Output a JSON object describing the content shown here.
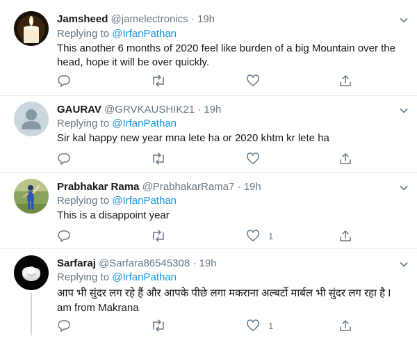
{
  "tweets": [
    {
      "name": "Jamsheed",
      "handle": "@jamelectronics",
      "time": "19h",
      "replying_label": "Replying to",
      "replying_to": "@IrfanPathan",
      "text": "This another 6 months of 2020 feel like burden of a big Mountain over the head, hope it will be over quickly.",
      "avatar": "candle-avatar",
      "reply_count": "",
      "retweet_count": "",
      "like_count": ""
    },
    {
      "name": "GAURAV",
      "handle": "@GRVKAUSHIK21",
      "time": "19h",
      "replying_label": "Replying to",
      "replying_to": "@IrfanPathan",
      "text": "Sir kal happy new year mna lete ha or 2020 khtm kr lete ha",
      "avatar": "default-avatar",
      "reply_count": "",
      "retweet_count": "",
      "like_count": ""
    },
    {
      "name": "Prabhakar Rama",
      "handle": "@PrabhakarRama7",
      "time": "19h",
      "replying_label": "Replying to",
      "replying_to": "@IrfanPathan",
      "text": "This is a disappoint year",
      "avatar": "cricket-avatar",
      "reply_count": "",
      "retweet_count": "",
      "like_count": "1"
    },
    {
      "name": "Sarfaraj",
      "handle": "@Sarfara86545308",
      "time": "19h",
      "replying_label": "Replying to",
      "replying_to": "@IrfanPathan",
      "text": "आप भी सुंदर लग रहे हैं और आपके पीछे लगा मकराना अल्बर्टो  मार्बल भी सुंदर लग  रहा है I am from Makrana",
      "avatar": "rose-avatar",
      "reply_count": "",
      "retweet_count": "",
      "like_count": "1"
    }
  ],
  "dot": "·",
  "colors": {
    "link": "#1b95e0",
    "secondary": "#657786",
    "divider": "#e6ecf0"
  }
}
